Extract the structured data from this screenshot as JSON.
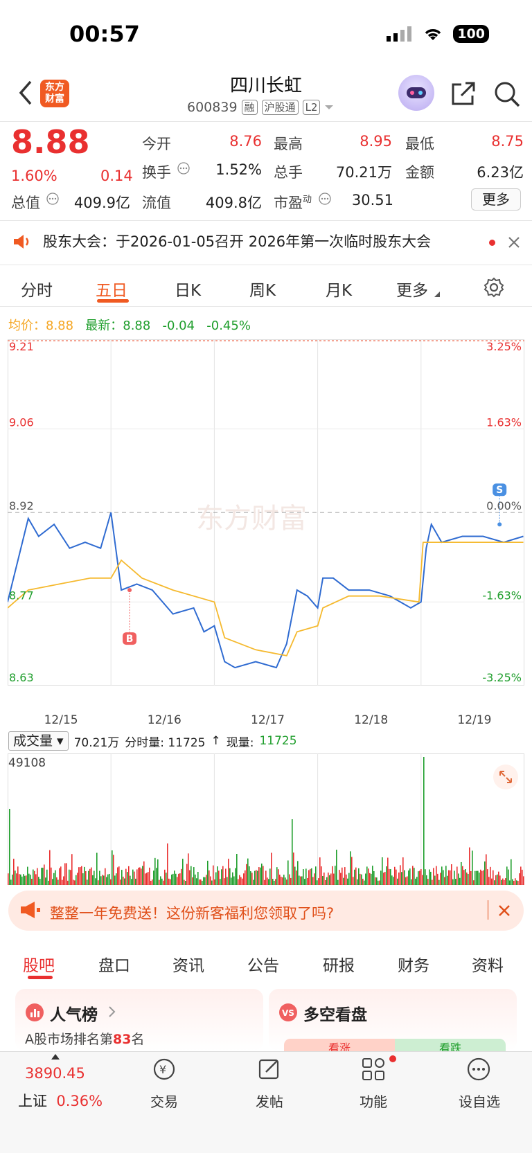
{
  "status_bar": {
    "time": "00:57",
    "battery": "100"
  },
  "header": {
    "logo_line1": "东方",
    "logo_line2": "财富",
    "name": "四川长虹",
    "code": "600839",
    "tags": [
      "融",
      "沪股通",
      "L2"
    ]
  },
  "quote": {
    "price": "8.88",
    "change_pct": "1.60%",
    "change": "0.14",
    "fields": [
      {
        "label": "今开",
        "value": "8.76",
        "color": "red"
      },
      {
        "label": "最高",
        "value": "8.95",
        "color": "red"
      },
      {
        "label": "最低",
        "value": "8.75",
        "color": "red"
      },
      {
        "label": "换手",
        "value": "1.52%",
        "color": "dark"
      },
      {
        "label": "总手",
        "value": "70.21万",
        "color": "dark"
      },
      {
        "label": "金额",
        "value": "6.23亿",
        "color": "dark"
      },
      {
        "label": "总值",
        "value": "409.9亿",
        "color": "dark"
      },
      {
        "label": "流值",
        "value": "409.8亿",
        "color": "dark"
      },
      {
        "label": "市盈",
        "sup": "动",
        "value": "30.51",
        "color": "dark"
      }
    ],
    "more_label": "更多"
  },
  "notice": {
    "text": "股东大会：于2026-01-05召开 2026年第一次临时股东大会"
  },
  "chart_tabs": [
    "分时",
    "五日",
    "日K",
    "周K",
    "月K",
    "更多"
  ],
  "legend": {
    "avg_label": "均价：",
    "avg_value": "8.88",
    "latest_label": "最新：",
    "latest_value": "8.88",
    "latest_change": "-0.04",
    "latest_pct": "-0.45%"
  },
  "chart_data": {
    "type": "line",
    "title": "",
    "x_dates": [
      "12/15",
      "12/16",
      "12/17",
      "12/18",
      "12/19"
    ],
    "y_left_ticks": [
      "9.21",
      "9.06",
      "8.92",
      "8.77",
      "8.63"
    ],
    "y_right_ticks": [
      "3.25%",
      "1.63%",
      "0.00%",
      "-1.63%",
      "-3.25%"
    ],
    "ylim": [
      8.63,
      9.21
    ],
    "pre_close": 8.92,
    "markers": [
      {
        "label": "B",
        "x": 1.18,
        "y": 8.79
      },
      {
        "label": "S",
        "x": 4.76,
        "y": 8.9
      }
    ],
    "series": [
      {
        "name": "",
        "color": "#2f6bd1",
        "x": [
          0,
          0.1,
          0.2,
          0.3,
          0.45,
          0.6,
          0.75,
          0.9,
          1.0,
          1.1,
          1.25,
          1.4,
          1.6,
          1.8,
          1.9,
          2.0,
          2.1,
          2.2,
          2.4,
          2.6,
          2.7,
          2.8,
          2.9,
          3.0,
          3.05,
          3.15,
          3.3,
          3.5,
          3.7,
          3.9,
          4.0,
          4.05,
          4.1,
          4.2,
          4.4,
          4.6,
          4.8,
          4.99
        ],
        "y": [
          8.77,
          8.84,
          8.91,
          8.88,
          8.9,
          8.86,
          8.87,
          8.86,
          8.92,
          8.79,
          8.8,
          8.79,
          8.75,
          8.76,
          8.72,
          8.73,
          8.67,
          8.66,
          8.67,
          8.66,
          8.7,
          8.79,
          8.78,
          8.76,
          8.81,
          8.81,
          8.79,
          8.79,
          8.78,
          8.76,
          8.77,
          8.86,
          8.9,
          8.87,
          8.88,
          8.88,
          8.87,
          8.88
        ]
      },
      {
        "name": "",
        "color": "#f5b92e",
        "x": [
          0,
          0.2,
          0.5,
          0.8,
          1.0,
          1.1,
          1.3,
          1.6,
          2.0,
          2.1,
          2.4,
          2.7,
          2.8,
          3.0,
          3.05,
          3.3,
          3.6,
          3.98,
          4.02,
          4.3,
          4.7,
          4.99
        ],
        "y": [
          8.76,
          8.79,
          8.8,
          8.81,
          8.81,
          8.84,
          8.81,
          8.79,
          8.77,
          8.71,
          8.69,
          8.68,
          8.72,
          8.73,
          8.76,
          8.78,
          8.78,
          8.77,
          8.87,
          8.87,
          8.87,
          8.87
        ]
      }
    ]
  },
  "volume": {
    "selector": "成交量",
    "total": "70.21万",
    "minute_label": "分时量: 11725",
    "arrow": "↑",
    "now_label": "现量:",
    "now_value": "11725",
    "max": "49108"
  },
  "banner": {
    "text": "整整一年免费送！这份新客福利您领取了吗?"
  },
  "section_tabs": [
    "股吧",
    "盘口",
    "资讯",
    "公告",
    "研报",
    "财务",
    "资料"
  ],
  "cards": {
    "left_title": "人气榜",
    "left_sub_prefix": "A股市场排名第",
    "left_sub_rank": "83",
    "left_sub_suffix": "名",
    "right_title": "多空看盘",
    "right_bull": "看涨",
    "right_bear": "看跌"
  },
  "bottom_bar": {
    "index_value": "3890.45",
    "index_name": "上证",
    "index_pct": "0.36%",
    "items": [
      "交易",
      "发帖",
      "功能",
      "设自选"
    ]
  }
}
